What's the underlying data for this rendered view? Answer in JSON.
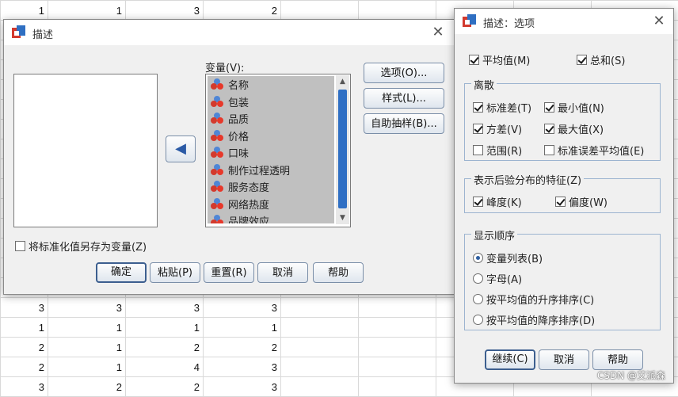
{
  "sheet": {
    "rows": [
      [
        "1",
        "1",
        "3",
        "2",
        "",
        "",
        "",
        "",
        ""
      ],
      [
        "",
        "",
        "",
        "",
        "",
        "",
        "",
        "",
        ""
      ],
      [
        "",
        "",
        "",
        "",
        "",
        "",
        "",
        "",
        ""
      ],
      [
        "",
        "",
        "",
        "",
        "",
        "",
        "",
        "",
        ""
      ],
      [
        "",
        "",
        "",
        "",
        "",
        "",
        "",
        "",
        ""
      ],
      [
        "",
        "",
        "",
        "",
        "",
        "",
        "",
        "",
        ""
      ],
      [
        "",
        "",
        "",
        "",
        "",
        "",
        "",
        "",
        ""
      ],
      [
        "",
        "",
        "",
        "",
        "",
        "",
        "",
        "",
        ""
      ],
      [
        "",
        "",
        "",
        "",
        "",
        "",
        "",
        "",
        ""
      ],
      [
        "",
        "",
        "",
        "",
        "",
        "",
        "",
        "",
        ""
      ],
      [
        "",
        "",
        "",
        "",
        "",
        "",
        "",
        "",
        ""
      ],
      [
        "",
        "",
        "",
        "",
        "",
        "",
        "",
        "",
        ""
      ],
      [
        "",
        "",
        "",
        "",
        "",
        "",
        "",
        "",
        ""
      ],
      [
        "",
        "",
        "",
        "",
        "",
        "",
        "",
        "",
        ""
      ],
      [
        "",
        "",
        "",
        "",
        "",
        "",
        "",
        "",
        ""
      ],
      [
        "3",
        "3",
        "3",
        "3",
        "",
        "",
        "",
        "",
        ""
      ],
      [
        "1",
        "1",
        "1",
        "1",
        "",
        "",
        "",
        "",
        ""
      ],
      [
        "2",
        "1",
        "2",
        "2",
        "",
        "",
        "",
        "",
        ""
      ],
      [
        "2",
        "1",
        "4",
        "3",
        "",
        "",
        "",
        "",
        ""
      ],
      [
        "3",
        "2",
        "2",
        "3",
        "",
        "",
        "",
        "",
        ""
      ]
    ]
  },
  "describe": {
    "title": "描述",
    "variables_label": "变量(V):",
    "variables": [
      "名称",
      "包装",
      "品质",
      "价格",
      "口味",
      "制作过程透明",
      "服务态度",
      "网络热度",
      "品牌效应"
    ],
    "side_buttons": [
      "选项(O)...",
      "样式(L)...",
      "自助抽样(B)..."
    ],
    "save_std_label": "将标准化值另存为变量(Z)",
    "buttons": [
      "确定",
      "粘贴(P)",
      "重置(R)",
      "取消",
      "帮助"
    ]
  },
  "options": {
    "title": "描述：选项",
    "mean_label": "平均值(M)",
    "sum_label": "总和(S)",
    "dispersion": {
      "label": "离散",
      "std_label": "标准差(T)",
      "min_label": "最小值(N)",
      "var_label": "方差(V)",
      "max_label": "最大值(X)",
      "range_label": "范围(R)",
      "sem_label": "标准误差平均值(E)"
    },
    "distribution": {
      "label": "表示后验分布的特征(Z)",
      "kurtosis_label": "峰度(K)",
      "skewness_label": "偏度(W)"
    },
    "display_order": {
      "label": "显示顺序",
      "variable_list": "变量列表(B)",
      "alphabetic": "字母(A)",
      "ascending": "按平均值的升序排序(C)",
      "descending": "按平均值的降序排序(D)"
    },
    "buttons": [
      "继续(C)",
      "取消",
      "帮助"
    ]
  },
  "watermark": "CSDN @艾派森"
}
